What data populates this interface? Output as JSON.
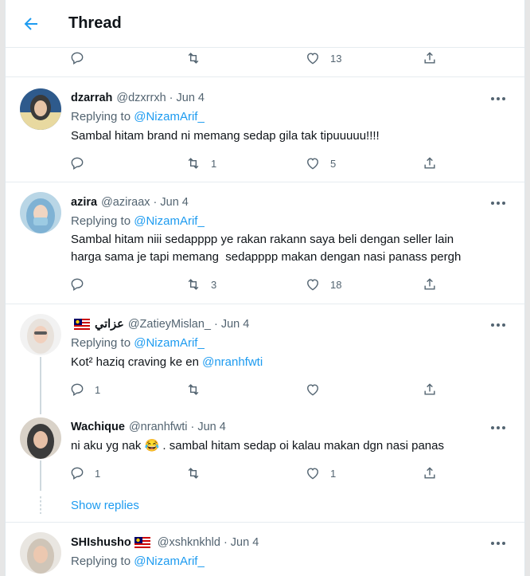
{
  "header": {
    "title": "Thread",
    "back_icon": "arrow-left-icon"
  },
  "top_actions": {
    "reply_count": "",
    "retweet_count": "",
    "like_count": "13"
  },
  "tweets": [
    {
      "name": "dzarrah",
      "handle": "@dzxrrxh",
      "date": "Jun 4",
      "replying_prefix": "Replying to",
      "replying_to": "@NizamArif_",
      "text": "Sambal hitam brand ni memang sedap gila tak tipuuuuu!!!!",
      "reply_count": "",
      "retweet_count": "1",
      "like_count": "5"
    },
    {
      "name": "azira",
      "handle": "@aziraax",
      "date": "Jun 4",
      "replying_prefix": "Replying to",
      "replying_to": "@NizamArif_",
      "text_line1": "Sambal hitam niii sedapppp ye rakan rakann saya beli dengan seller lain",
      "text_line2": "harga sama je tapi memang  sedapppp makan dengan nasi panass pergh",
      "reply_count": "",
      "retweet_count": "3",
      "like_count": "18"
    },
    {
      "name": "عزاتي",
      "handle": "@ZatieyMislan_",
      "date": "Jun 4",
      "replying_prefix": "Replying to",
      "replying_to": "@NizamArif_",
      "text_prefix": "Kot² haziq craving ke en ",
      "text_mention": "@nranhfwti",
      "reply_count": "1",
      "retweet_count": "",
      "like_count": ""
    },
    {
      "name": "Wachique",
      "handle": "@nranhfwti",
      "date": "Jun 4",
      "text_prefix": "ni aku yg nak ",
      "emoji": "😂",
      "text_suffix": " . sambal hitam sedap oi kalau makan dgn nasi panas",
      "reply_count": "1",
      "retweet_count": "",
      "like_count": "1"
    },
    {
      "name": "SHIshusho",
      "handle": "@xshknkhld",
      "date": "Jun 4",
      "replying_prefix": "Replying to",
      "replying_to": "@NizamArif_"
    }
  ],
  "show_replies": "Show replies",
  "colors": {
    "accent": "#1d9bf0",
    "muted": "#536471",
    "text": "#0f1419"
  }
}
